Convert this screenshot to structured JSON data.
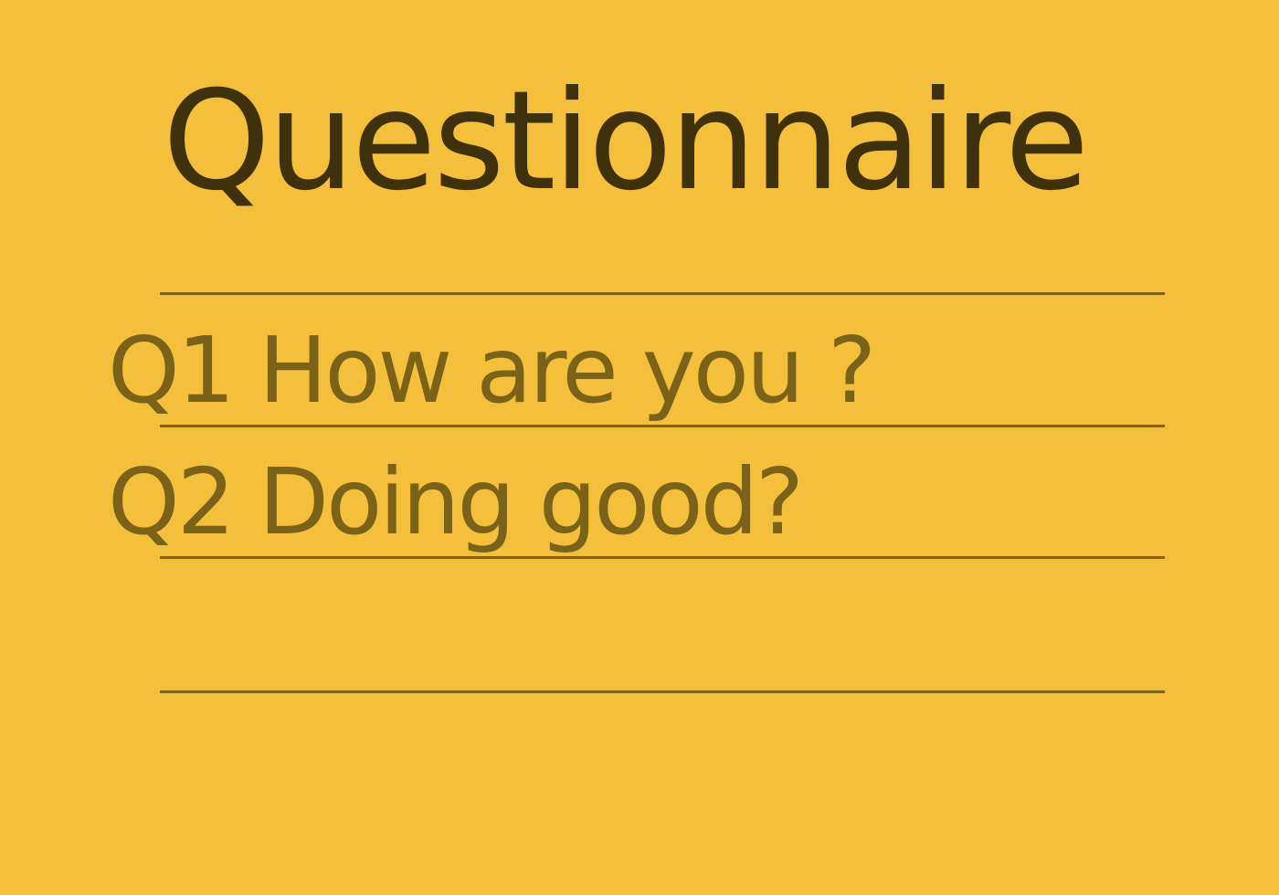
{
  "note": {
    "title": "Questionnaire",
    "lines": [
      {
        "text": "Q1 How are you ?"
      },
      {
        "text": "Q2 Doing good?"
      }
    ]
  },
  "colors": {
    "background": "#F4BF3A",
    "title": "#3E310B",
    "text": "#7A6219",
    "rule": "#7A6219"
  }
}
